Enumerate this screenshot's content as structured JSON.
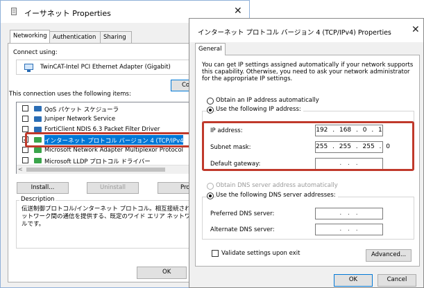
{
  "back_window": {
    "title": "イーサネット Properties",
    "close_glyph": "✕",
    "tabs": [
      {
        "label": "Networking"
      },
      {
        "label": "Authentication"
      },
      {
        "label": "Sharing"
      }
    ],
    "connect_using_label": "Connect using:",
    "adapter_name": "TwinCAT-Intel PCI Ethernet Adapter (Gigabit)",
    "configure_button": "Co",
    "items_label": "This connection uses the following items:",
    "items": [
      {
        "label": "QoS パケット スケジューラ",
        "checked": false
      },
      {
        "label": "Juniper Network Service",
        "checked": false
      },
      {
        "label": "FortiClient NDIS 6.3 Packet Filter Driver",
        "checked": false
      },
      {
        "label": "インターネット プロトコル バージョン 4 (TCP/IPv4)",
        "checked": true
      },
      {
        "label": "Microsoft Network Adapter Multiplexor Protocol",
        "checked": false
      },
      {
        "label": "Microsoft LLDP プロトコル ドライバー",
        "checked": false
      }
    ],
    "scroll_left_glyph": "<",
    "install_button": "Install...",
    "uninstall_button": "Uninstall",
    "properties_button": "Pro",
    "description_label": "Description",
    "description_text": "伝送制御プロトコル/インターネット プロトコル。相互接続されたさまざまなネットワーク間の通信を提供する、既定のワイド エリア ネットワーク プロトコルです。",
    "ok_button": "OK"
  },
  "front_window": {
    "title": "インターネット プロトコル バージョン 4 (TCP/IPv4) Properties",
    "close_glyph": "✕",
    "tab": "General",
    "info_text": "You can get IP settings assigned automatically if your network supports this capability. Otherwise, you need to ask your network administrator for the appropriate IP settings.",
    "obtain_ip_auto": "Obtain an IP address automatically",
    "use_following_ip": "Use the following IP address:",
    "ip_address_label": "IP address:",
    "ip_address_value": "192 . 168 . 0 . 1",
    "subnet_mask_label": "Subnet mask:",
    "subnet_mask_value": "255 . 255 . 255 . 0",
    "default_gateway_label": "Default gateway:",
    "default_gateway_value": ". . .",
    "obtain_dns_auto": "Obtain DNS server address automatically",
    "use_following_dns": "Use the following DNS server addresses:",
    "preferred_dns_label": "Preferred DNS server:",
    "preferred_dns_value": ". . .",
    "alternate_dns_label": "Alternate DNS server:",
    "alternate_dns_value": ". . .",
    "validate_label": "Validate settings upon exit",
    "advanced_button": "Advanced...",
    "ok_button": "OK",
    "cancel_button": "Cancel"
  },
  "colors": {
    "highlight": "#c0392b",
    "selection": "#0078d7"
  }
}
